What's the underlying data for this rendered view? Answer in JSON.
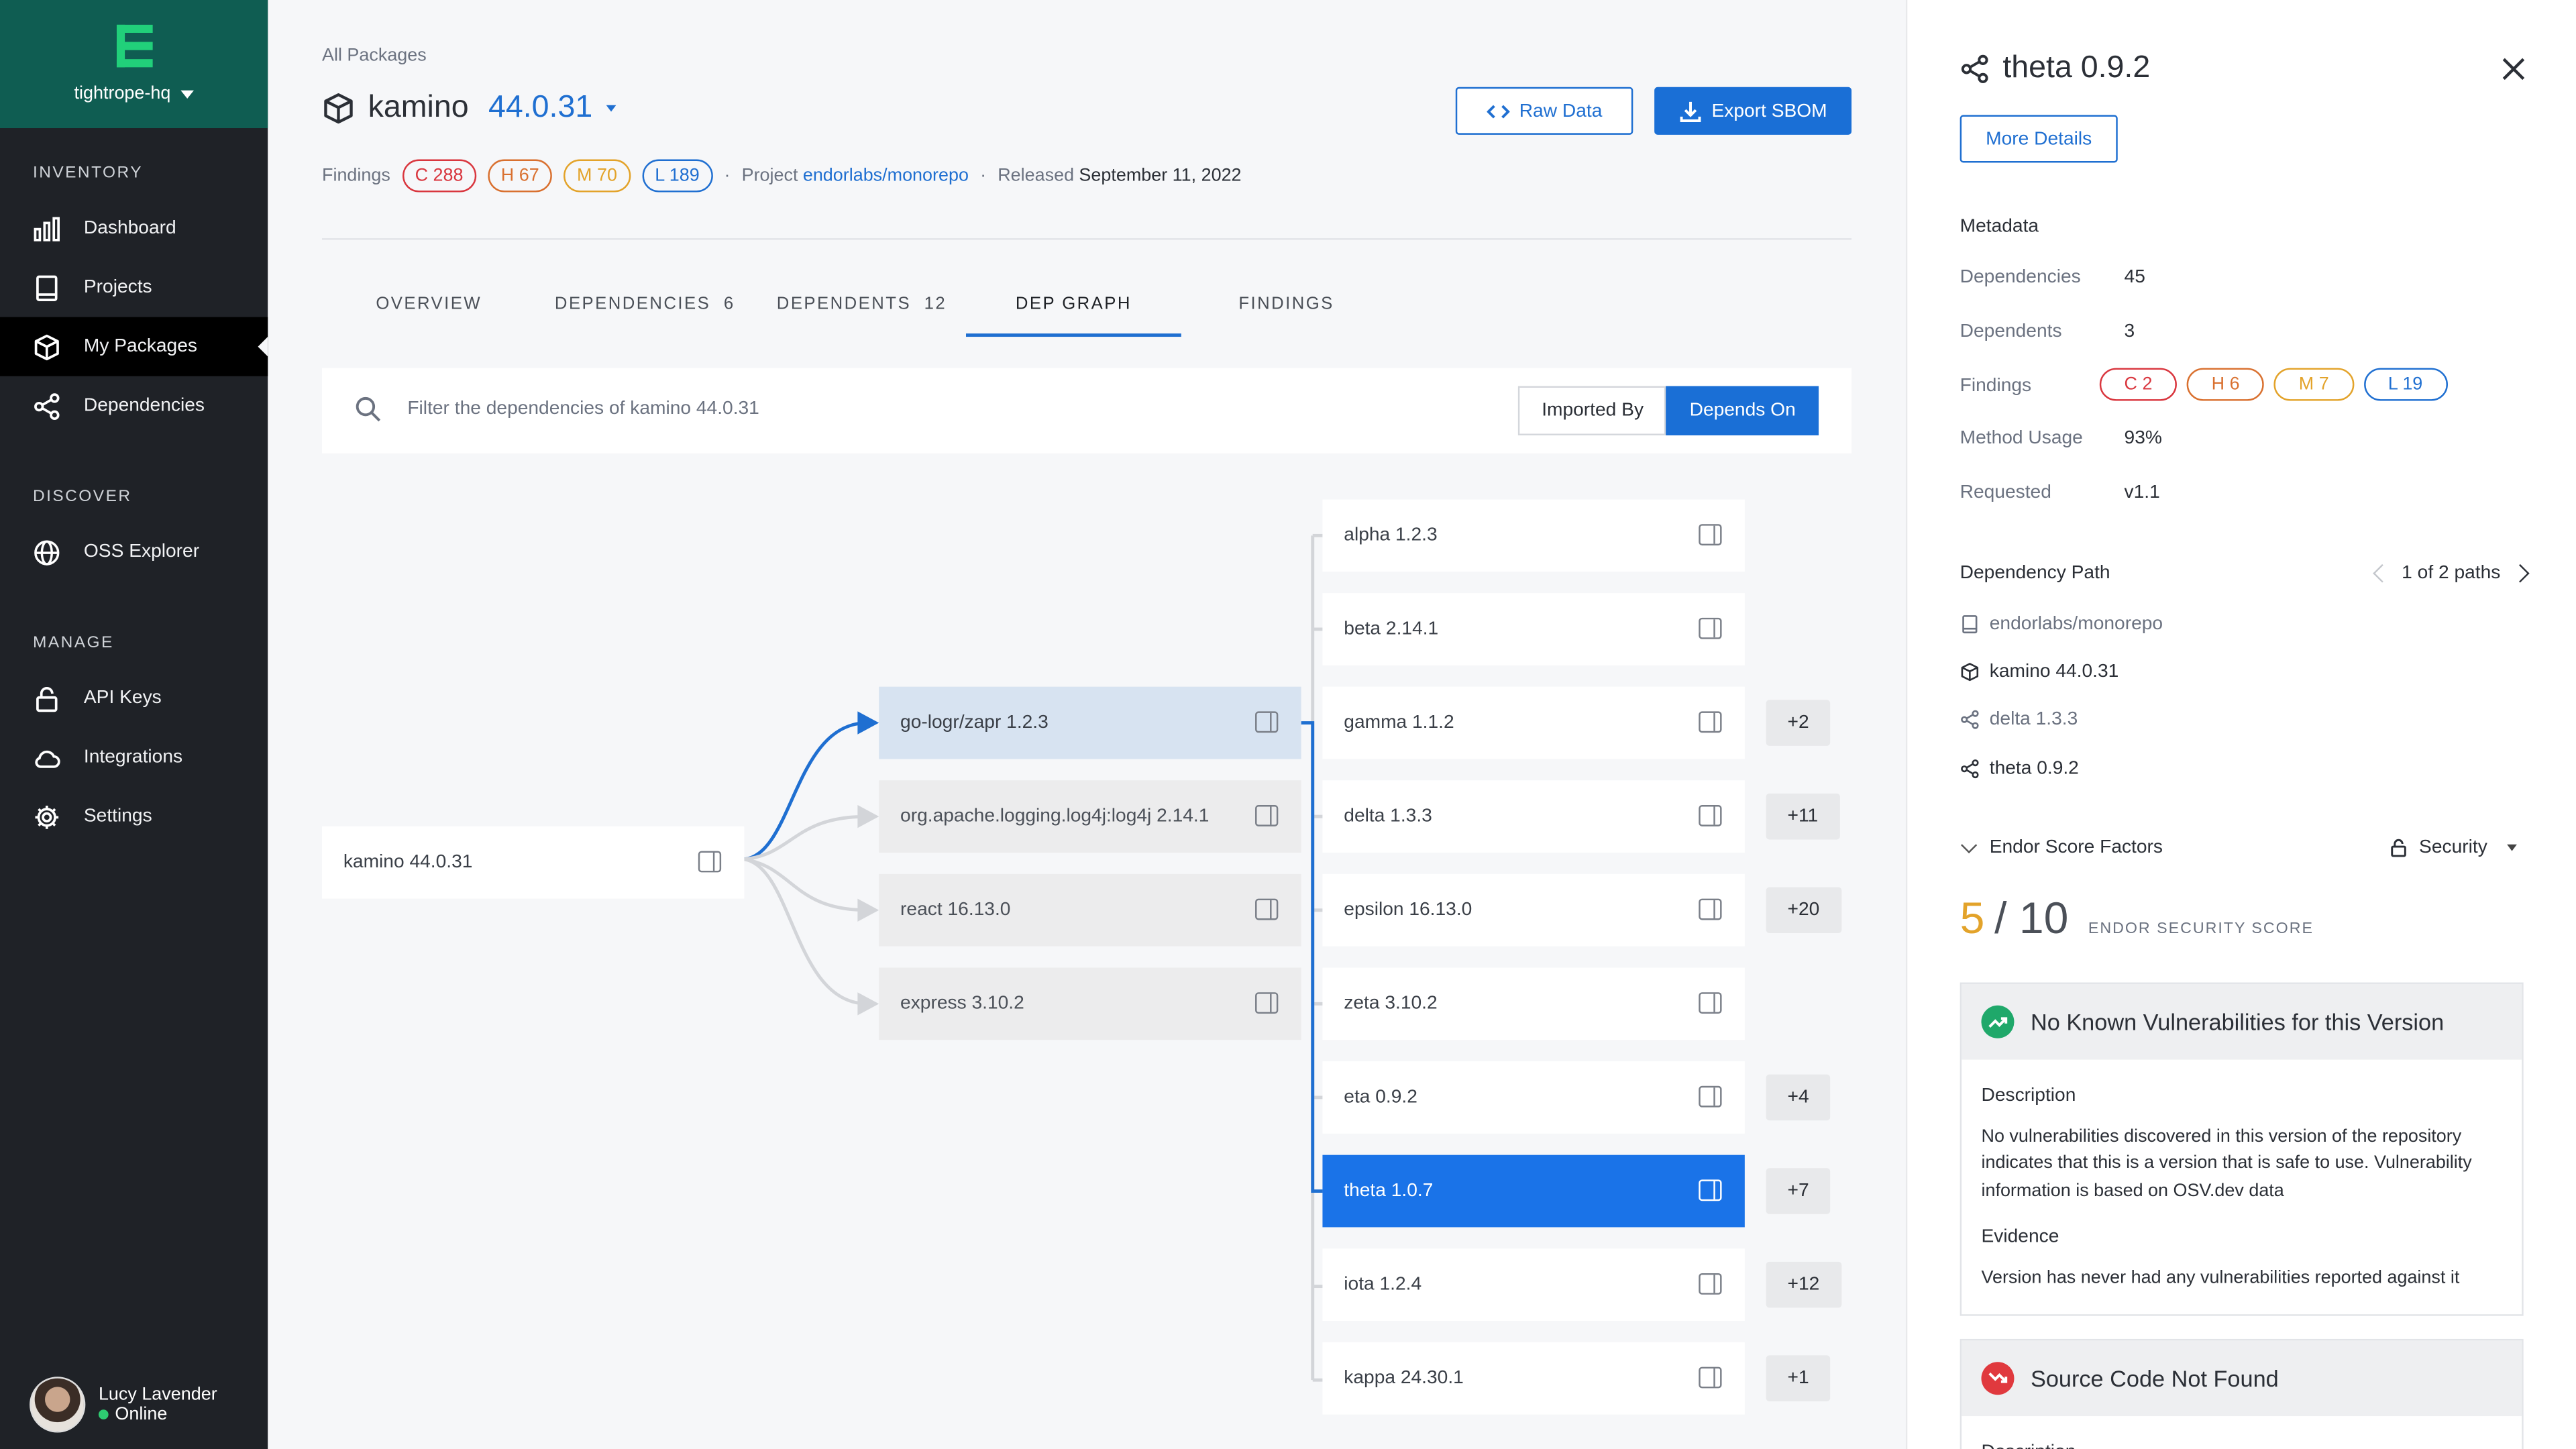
{
  "sidebar": {
    "org": "tightrope-hq",
    "sections": [
      {
        "title": "INVENTORY",
        "items": [
          "Dashboard",
          "Projects",
          "My Packages",
          "Dependencies"
        ]
      },
      {
        "title": "DISCOVER",
        "items": [
          "OSS Explorer"
        ]
      },
      {
        "title": "MANAGE",
        "items": [
          "API Keys",
          "Integrations",
          "Settings"
        ]
      }
    ],
    "user": {
      "name": "Lucy Lavender",
      "status": "Online"
    }
  },
  "header": {
    "breadcrumb": "All Packages",
    "package_name": "kamino",
    "version": "44.0.31",
    "raw_data": "Raw Data",
    "export_sbom": "Export SBOM",
    "findings_label": "Findings",
    "findings": {
      "critical": "C 288",
      "high": "H 67",
      "medium": "M 70",
      "low": "L 189"
    },
    "project_label": "Project",
    "project": "endorlabs/monorepo",
    "released_label": "Released",
    "released": "September 11, 2022",
    "sep": "·"
  },
  "tabs": [
    {
      "label": "OVERVIEW",
      "count": ""
    },
    {
      "label": "DEPENDENCIES",
      "count": "6"
    },
    {
      "label": "DEPENDENTS",
      "count": "12"
    },
    {
      "label": "DEP GRAPH",
      "count": ""
    },
    {
      "label": "FINDINGS",
      "count": ""
    }
  ],
  "filter": {
    "placeholder": "Filter the dependencies of kamino 44.0.31",
    "imported_by": "Imported By",
    "depends_on": "Depends On"
  },
  "graph": {
    "root": "kamino 44.0.31",
    "level1": [
      "go-logr/zapr 1.2.3",
      "org.apache.logging.log4j:log4j 2.14.1",
      "react 16.13.0",
      "express 3.10.2"
    ],
    "level2": [
      {
        "label": "alpha 1.2.3",
        "more": ""
      },
      {
        "label": "beta 2.14.1",
        "more": ""
      },
      {
        "label": "gamma 1.1.2",
        "more": "+2"
      },
      {
        "label": "delta 1.3.3",
        "more": "+11"
      },
      {
        "label": "epsilon 16.13.0",
        "more": "+20"
      },
      {
        "label": "zeta 3.10.2",
        "more": ""
      },
      {
        "label": "eta 0.9.2",
        "more": "+4"
      },
      {
        "label": "theta 1.0.7",
        "more": "+7"
      },
      {
        "label": "iota 1.2.4",
        "more": "+12"
      },
      {
        "label": "kappa 24.30.1",
        "more": "+1"
      }
    ]
  },
  "panel": {
    "title": "theta 0.9.2",
    "more_details": "More Details",
    "metadata_title": "Metadata",
    "metadata": [
      {
        "k": "Dependencies",
        "v": "45"
      },
      {
        "k": "Dependents",
        "v": "3"
      },
      {
        "k": "Findings",
        "v": ""
      },
      {
        "k": "Method Usage",
        "v": "93%"
      },
      {
        "k": "Requested",
        "v": "v1.1"
      }
    ],
    "findings": {
      "c": "C 2",
      "h": "H 6",
      "m": "M 7",
      "l": "L 19"
    },
    "dep_path_title": "Dependency Path",
    "paths": "1 of 2 paths",
    "path": [
      "endorlabs/monorepo",
      "kamino 44.0.31",
      "delta 1.3.3",
      "theta 0.9.2"
    ],
    "score_factors": "Endor Score Factors",
    "security": "Security",
    "score": "5",
    "score_of": "/ 10",
    "score_label": "ENDOR SECURITY SCORE",
    "card1": {
      "title": "No Known Vulnerabilities for this Version",
      "desc_title": "Description",
      "desc": "No vulnerabilities discovered in this version of the repository indicates that this is a version that is safe to use. Vulnerability information is based on OSV.dev data",
      "ev_title": "Evidence",
      "ev": "Version has never had any vulnerabilities reported against it"
    },
    "card2": {
      "title": "Source Code Not Found",
      "desc_title": "Description"
    }
  },
  "colors": {
    "accent": "#1a6fd6",
    "brand": "#0f5d52",
    "critical": "#d9363e",
    "high": "#d9702f",
    "medium": "#e3a32a",
    "low": "#1f6fd1"
  }
}
